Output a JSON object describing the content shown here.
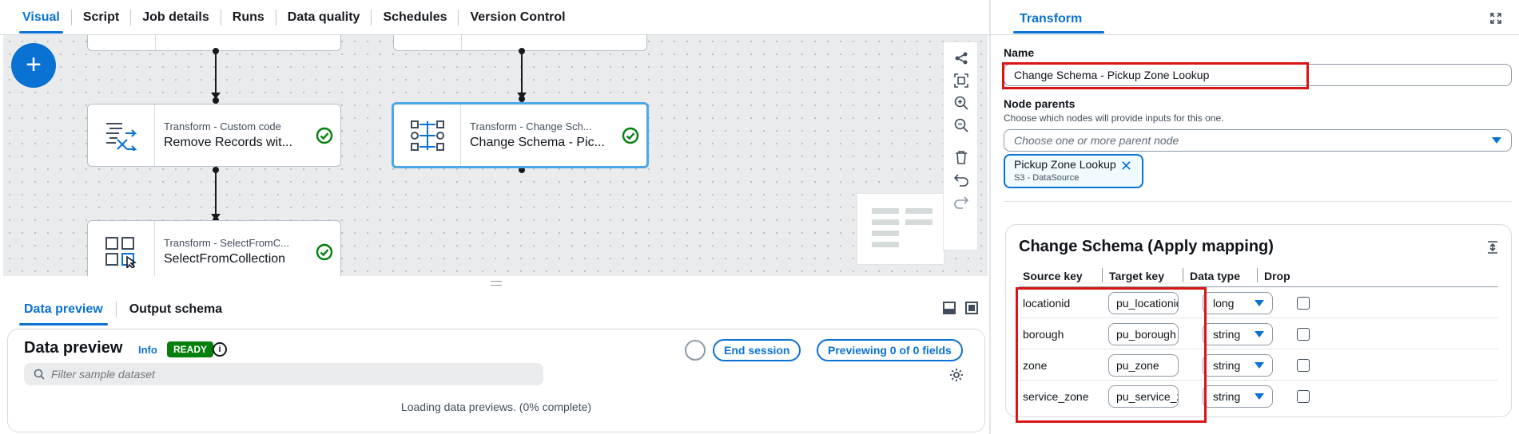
{
  "top_tabs": [
    "Visual",
    "Script",
    "Job details",
    "Runs",
    "Data quality",
    "Schedules",
    "Version Control"
  ],
  "canvas": {
    "add_label": "+",
    "nodes": {
      "remove_records": {
        "type": "Transform - Custom code",
        "name": "Remove Records wit..."
      },
      "change_schema": {
        "type": "Transform - Change Sch...",
        "name": "Change Schema - Pic..."
      },
      "select_from_collection": {
        "type": "Transform - SelectFromC...",
        "name": "SelectFromCollection"
      }
    }
  },
  "bottom_tabs": [
    "Data preview",
    "Output schema"
  ],
  "data_preview": {
    "title": "Data preview",
    "info": "Info",
    "status": "READY",
    "info_icon": "i",
    "end_session": "End session",
    "previewing": "Previewing 0 of 0 fields",
    "filter_placeholder": "Filter sample dataset",
    "loading": "Loading data previews. (0% complete)"
  },
  "panel": {
    "tab": "Transform",
    "name_label": "Name",
    "name_value": "Change Schema - Pickup Zone Lookup",
    "parents_label": "Node parents",
    "parents_desc": "Choose which nodes will provide inputs for this one.",
    "parents_placeholder": "Choose one or more parent node",
    "parent_token": {
      "name": "Pickup Zone Lookup",
      "sub": "S3 - DataSource",
      "remove": "✕"
    },
    "mapping": {
      "title": "Change Schema (Apply mapping)",
      "headers": {
        "source": "Source key",
        "target": "Target key",
        "type": "Data type",
        "drop": "Drop"
      },
      "rows": [
        {
          "source": "locationid",
          "target": "pu_locationid",
          "type": "long",
          "drop": false
        },
        {
          "source": "borough",
          "target": "pu_borough",
          "type": "string",
          "drop": false
        },
        {
          "source": "zone",
          "target": "pu_zone",
          "type": "string",
          "drop": false
        },
        {
          "source": "service_zone",
          "target": "pu_service_zone",
          "type": "string",
          "drop": false
        }
      ]
    }
  },
  "colors": {
    "accent": "#0972d3",
    "highlight": "#d91515",
    "ready": "#037f0c",
    "success": "#037f0c"
  }
}
